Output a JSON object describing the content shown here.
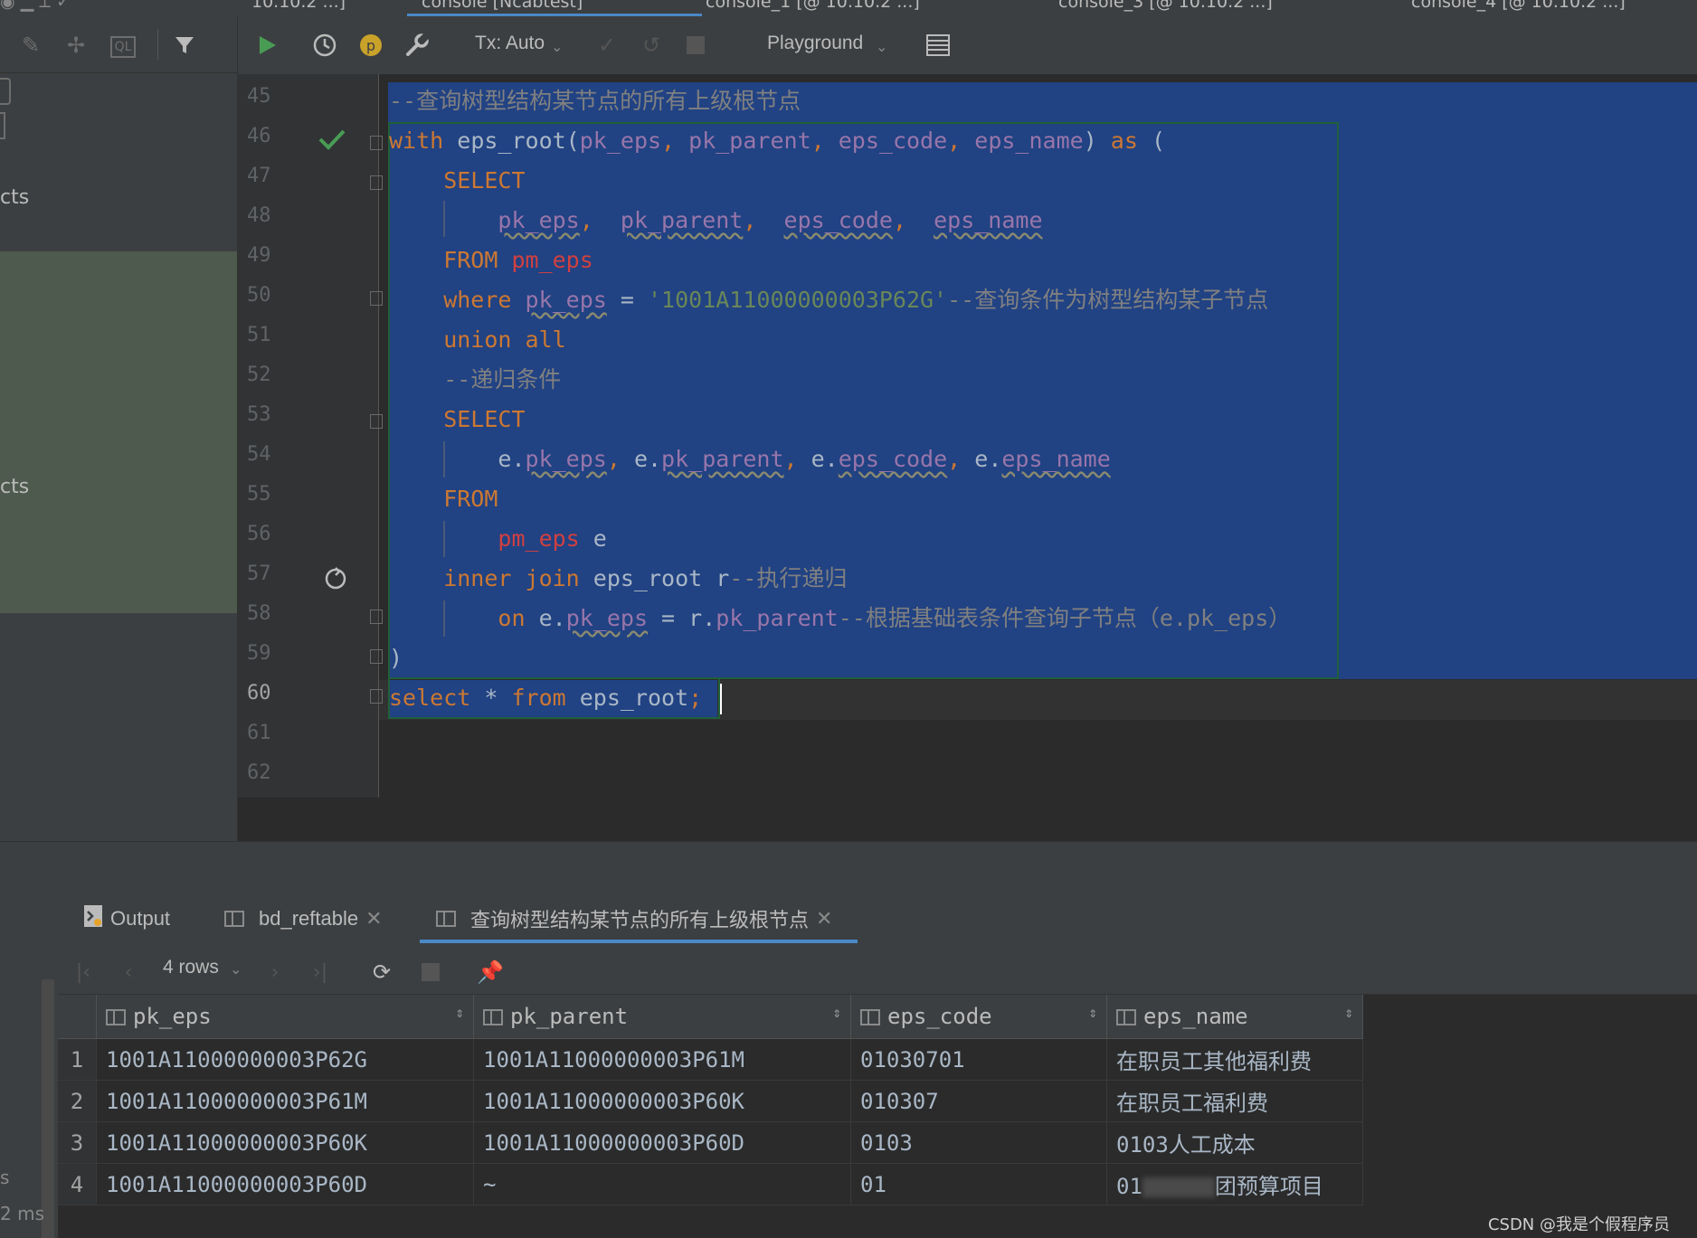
{
  "file_tabs": [
    {
      "label": "10.10.2 ...]",
      "active": false
    },
    {
      "label": "console [Ncabtest]",
      "active": true
    },
    {
      "label": "console_1 [@ 10.10.2 ...]",
      "active": false
    },
    {
      "label": "console_3 [@ 10.10.2 ...]",
      "active": false
    },
    {
      "label": "console_4 [@ 10.10.2 ...]",
      "active": false
    }
  ],
  "sidebar": {
    "item_a": "cts",
    "item_b": "cts",
    "footer_a": "s",
    "footer_b": "2 ms"
  },
  "toolbar": {
    "tx_mode": "Tx: Auto",
    "session": "Playground",
    "icons": [
      "run-icon",
      "history-icon",
      "p-badge-icon",
      "wrench-icon",
      "commit-icon",
      "rollback-icon",
      "stop-icon",
      "table-view-icon"
    ]
  },
  "editor": {
    "line_numbers": [
      "45",
      "46",
      "47",
      "48",
      "49",
      "50",
      "51",
      "52",
      "53",
      "54",
      "55",
      "56",
      "57",
      "58",
      "59",
      "60",
      "61",
      "62"
    ],
    "current_line": "60",
    "lines": [
      [
        {
          "t": "--查询树型结构某节点的所有上级根节点",
          "c": "cm"
        }
      ],
      [
        {
          "t": "with ",
          "c": "kw"
        },
        {
          "t": "eps_root(",
          "c": ""
        },
        {
          "t": "pk_eps",
          "c": "id"
        },
        {
          "t": ", ",
          "c": "kw"
        },
        {
          "t": "pk_parent",
          "c": "id"
        },
        {
          "t": ", ",
          "c": "kw"
        },
        {
          "t": "eps_code",
          "c": "id"
        },
        {
          "t": ", ",
          "c": "kw"
        },
        {
          "t": "eps_name",
          "c": "id"
        },
        {
          "t": ") ",
          "c": ""
        },
        {
          "t": "as",
          "c": "kw"
        },
        {
          "t": " (",
          "c": ""
        }
      ],
      [
        {
          "t": "    SELECT",
          "c": "kw"
        }
      ],
      [
        {
          "t": "        ",
          "c": ""
        },
        {
          "t": "pk_eps",
          "c": "id wv"
        },
        {
          "t": ",  ",
          "c": "kw"
        },
        {
          "t": "pk_parent",
          "c": "id wv"
        },
        {
          "t": ",  ",
          "c": "kw"
        },
        {
          "t": "eps_code",
          "c": "id wv"
        },
        {
          "t": ",  ",
          "c": "kw"
        },
        {
          "t": "eps_name",
          "c": "id wv"
        }
      ],
      [
        {
          "t": "    FROM ",
          "c": "kw"
        },
        {
          "t": "pm_eps",
          "c": "tb"
        }
      ],
      [
        {
          "t": "    where ",
          "c": "kw"
        },
        {
          "t": "pk_eps",
          "c": "id wv"
        },
        {
          "t": " = ",
          "c": ""
        },
        {
          "t": "'1001A11000000003P62G'",
          "c": "str"
        },
        {
          "t": "--查询条件为树型结构某子节点",
          "c": "cm"
        }
      ],
      [
        {
          "t": "    union all",
          "c": "kw"
        }
      ],
      [
        {
          "t": "    --递归条件",
          "c": "cm"
        }
      ],
      [
        {
          "t": "    SELECT",
          "c": "kw"
        }
      ],
      [
        {
          "t": "        e.",
          "c": ""
        },
        {
          "t": "pk_eps",
          "c": "id wv"
        },
        {
          "t": ", ",
          "c": "kw"
        },
        {
          "t": "e.",
          "c": ""
        },
        {
          "t": "pk_parent",
          "c": "id wv"
        },
        {
          "t": ", ",
          "c": "kw"
        },
        {
          "t": "e.",
          "c": ""
        },
        {
          "t": "eps_code",
          "c": "id wv"
        },
        {
          "t": ", ",
          "c": "kw"
        },
        {
          "t": "e.",
          "c": ""
        },
        {
          "t": "eps_name",
          "c": "id wv"
        }
      ],
      [
        {
          "t": "    FROM",
          "c": "kw"
        }
      ],
      [
        {
          "t": "        ",
          "c": ""
        },
        {
          "t": "pm_eps",
          "c": "tb"
        },
        {
          "t": " e",
          "c": ""
        }
      ],
      [
        {
          "t": "    inner join ",
          "c": "kw"
        },
        {
          "t": "eps_root r",
          "c": ""
        },
        {
          "t": "--执行递归",
          "c": "cm"
        }
      ],
      [
        {
          "t": "        on ",
          "c": "kw"
        },
        {
          "t": "e.",
          "c": ""
        },
        {
          "t": "pk_eps",
          "c": "id wv"
        },
        {
          "t": " = r.",
          "c": ""
        },
        {
          "t": "pk_parent",
          "c": "id"
        },
        {
          "t": "--根据基础表条件查询子节点（e.pk_eps）",
          "c": "cm"
        }
      ],
      [
        {
          "t": ")",
          "c": ""
        }
      ],
      [
        {
          "t": "select",
          "c": "kw"
        },
        {
          "t": " * ",
          "c": ""
        },
        {
          "t": "from",
          "c": "kw"
        },
        {
          "t": " eps_root",
          "c": ""
        },
        {
          "t": ";",
          "c": "kw"
        }
      ],
      [],
      []
    ]
  },
  "results": {
    "tabs": [
      {
        "label": "Output",
        "closable": false
      },
      {
        "label": "bd_reftable",
        "closable": true
      },
      {
        "label": "查询树型结构某节点的所有上级根节点",
        "closable": true
      }
    ],
    "row_count": "4 rows",
    "columns": [
      "pk_eps",
      "pk_parent",
      "eps_code",
      "eps_name"
    ],
    "rows": [
      {
        "n": "1",
        "cells": [
          "1001A11000000003P62G",
          "1001A11000000003P61M",
          "01030701",
          "在职员工其他福利费"
        ]
      },
      {
        "n": "2",
        "cells": [
          "1001A11000000003P61M",
          "1001A11000000003P60K",
          "010307",
          "在职员工福利费"
        ]
      },
      {
        "n": "3",
        "cells": [
          "1001A11000000003P60K",
          "1001A11000000003P60D",
          "0103",
          "0103人工成本"
        ]
      },
      {
        "n": "4",
        "cells": [
          "1001A11000000003P60D",
          "~",
          "01",
          "01 团预算项目"
        ]
      }
    ],
    "row4_name_parts": [
      "01",
      "团预算项目"
    ]
  },
  "watermark": "CSDN @我是个假程序员",
  "colors": {
    "selection": "#214283",
    "keyword": "#cc7832",
    "identifier": "#9876aa",
    "string": "#6a8759",
    "comment": "#808080",
    "run": "#499c54"
  }
}
